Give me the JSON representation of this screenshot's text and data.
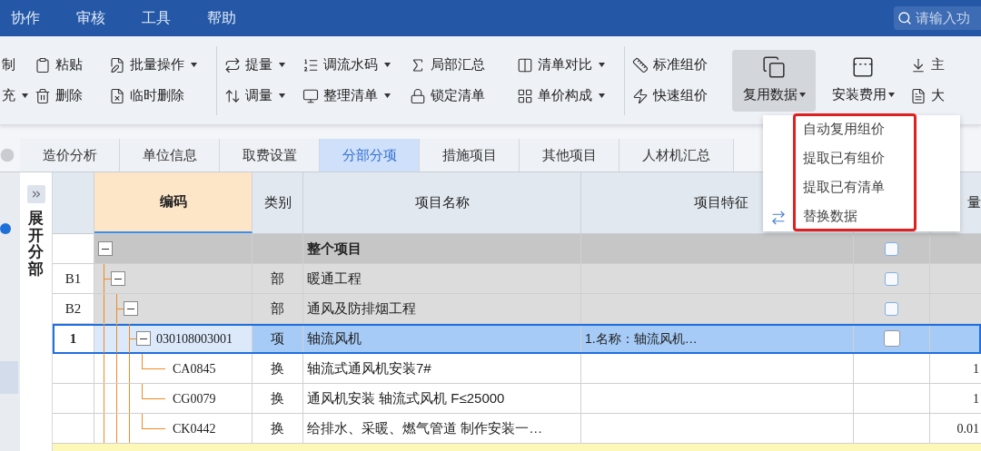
{
  "menu": {
    "items": [
      "协作",
      "审核",
      "工具",
      "帮助"
    ]
  },
  "search": {
    "placeholder": "请输入功"
  },
  "toolbar": {
    "columns": [
      {
        "kind": "stack",
        "items": [
          {
            "label": "制",
            "dropdown": false
          },
          {
            "label": "充",
            "dropdown": true
          }
        ]
      },
      {
        "kind": "stack",
        "items": [
          {
            "label": "粘贴",
            "dropdown": false
          },
          {
            "label": "删除",
            "dropdown": false
          }
        ]
      },
      {
        "kind": "stack",
        "items": [
          {
            "label": "批量操作",
            "dropdown": true
          },
          {
            "label": "临时删除",
            "dropdown": false
          }
        ]
      },
      {
        "kind": "separator"
      },
      {
        "kind": "stack",
        "items": [
          {
            "label": "提量",
            "dropdown": true
          },
          {
            "label": "调量",
            "dropdown": true
          }
        ]
      },
      {
        "kind": "stack",
        "items": [
          {
            "label": "调流水码",
            "dropdown": true
          },
          {
            "label": "整理清单",
            "dropdown": true
          }
        ]
      },
      {
        "kind": "stack",
        "items": [
          {
            "label": "局部汇总",
            "dropdown": false
          },
          {
            "label": "锁定清单",
            "dropdown": false
          }
        ]
      },
      {
        "kind": "stack",
        "items": [
          {
            "label": "清单对比",
            "dropdown": true
          },
          {
            "label": "单价构成",
            "dropdown": true
          }
        ]
      },
      {
        "kind": "separator"
      },
      {
        "kind": "stack",
        "items": [
          {
            "label": "标准组价",
            "dropdown": false
          },
          {
            "label": "快速组价",
            "dropdown": false
          }
        ]
      },
      {
        "kind": "large",
        "label": "复用数据",
        "dropdown": true,
        "selected": true
      },
      {
        "kind": "large",
        "label": "安装费用",
        "dropdown": true,
        "selected": false
      },
      {
        "kind": "stack",
        "items": [
          {
            "label": "主",
            "dropdown": false
          },
          {
            "label": "大",
            "dropdown": false
          }
        ]
      }
    ]
  },
  "dropdown_menu": {
    "items": [
      "自动复用组价",
      "提取已有组价",
      "提取已有清单",
      "替换数据"
    ]
  },
  "tabs": [
    {
      "label": "造价分析",
      "selected": false
    },
    {
      "label": "单位信息",
      "selected": false
    },
    {
      "label": "取费设置",
      "selected": false
    },
    {
      "label": "分部分项",
      "selected": true
    },
    {
      "label": "措施项目",
      "selected": false
    },
    {
      "label": "其他项目",
      "selected": false
    },
    {
      "label": "人材机汇总",
      "selected": false
    }
  ],
  "side_panel": {
    "label": "展开分部"
  },
  "table": {
    "header": {
      "code": "编码",
      "type": "类别",
      "name": "项目名称",
      "feature": "项目特征",
      "amount": "量"
    },
    "rows": [
      {
        "kind": "total",
        "name": "整个项目",
        "expanded": true,
        "checked": false,
        "selected": false,
        "children": [
          {
            "kind": "division",
            "row_no": "B1",
            "type": "部",
            "name": "暖通工程",
            "expanded": true,
            "checked": false,
            "selected": false,
            "children": [
              {
                "kind": "division",
                "row_no": "B2",
                "type": "部",
                "name": "通风及防排烟工程",
                "expanded": true,
                "checked": false,
                "selected": false,
                "children": [
                  {
                    "kind": "item",
                    "row_no": "1",
                    "code": "030108003001",
                    "type": "项",
                    "name": "轴流风机",
                    "feature": "1.名称：轴流风机…",
                    "expanded": true,
                    "checked": false,
                    "selected": true,
                    "children": [
                      {
                        "kind": "sub",
                        "code": "CA0845",
                        "type": "换",
                        "name": "轴流式通风机安装7#",
                        "amount": "1",
                        "selected": false
                      },
                      {
                        "kind": "sub",
                        "code": "CG0079",
                        "type": "换",
                        "name": "通风机安装 轴流式风机 F≤25000",
                        "amount": "1",
                        "selected": false
                      },
                      {
                        "kind": "sub",
                        "code": "CK0442",
                        "type": "换",
                        "name": "给排水、采暖、燃气管道 制作安装一…",
                        "amount": "0.01",
                        "selected": false
                      }
                    ]
                  }
                ]
              }
            ]
          }
        ]
      }
    ]
  }
}
